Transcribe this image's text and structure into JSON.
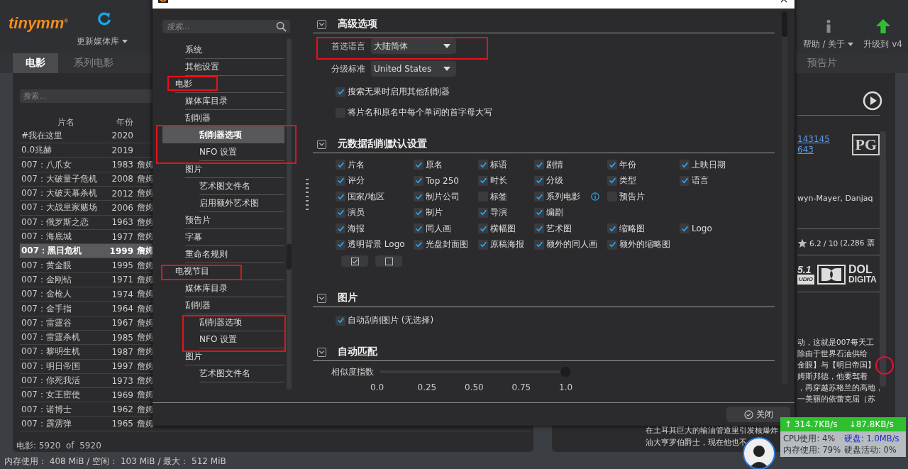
{
  "app": {
    "logo": "tinymm",
    "logo_mark": "®",
    "toolbar": [
      {
        "label": "更新媒体库",
        "dropdown": true
      }
    ],
    "toolbar_right": [
      {
        "kind": "help",
        "label": "帮助 / 关于",
        "dropdown": true
      },
      {
        "kind": "upgrade",
        "label": "升级到 v4",
        "dropdown": false
      }
    ],
    "tabs": [
      {
        "label": "电影",
        "selected": true
      },
      {
        "label": "系列电影",
        "selected": false
      }
    ],
    "tabs_right": [
      {
        "label": "预告片",
        "selected": false
      }
    ]
  },
  "movie_list": {
    "search": {
      "placeholder": "搜索..."
    },
    "columns": [
      "片名",
      "年份"
    ],
    "rows": [
      {
        "title": "#我在这里",
        "year": "2020",
        "column_3": "",
        "selected": false
      },
      {
        "title": "0.0兆赫",
        "year": "2019",
        "column_3": "",
        "selected": false
      },
      {
        "title": "007：八爪女",
        "year": "1983",
        "column_3": "詹姆",
        "selected": false
      },
      {
        "title": "007：大破量子危机",
        "year": "2008",
        "column_3": "詹姆",
        "selected": false
      },
      {
        "title": "007：大破天幕杀机",
        "year": "2012",
        "column_3": "詹姆",
        "selected": false
      },
      {
        "title": "007：大战皇家赌场",
        "year": "2006",
        "column_3": "詹姆",
        "selected": false
      },
      {
        "title": "007：俄罗斯之恋",
        "year": "1963",
        "column_3": "詹姆",
        "selected": false
      },
      {
        "title": "007：海底城",
        "year": "1977",
        "column_3": "詹姆",
        "selected": false
      },
      {
        "title": "007：黑日危机",
        "year": "1999",
        "column_3": "詹姆",
        "selected": true
      },
      {
        "title": "007：黄金眼",
        "year": "1995",
        "column_3": "詹姆",
        "selected": false
      },
      {
        "title": "007：金刚钻",
        "year": "1971",
        "column_3": "詹姆",
        "selected": false
      },
      {
        "title": "007：金枪人",
        "year": "1974",
        "column_3": "詹姆",
        "selected": false
      },
      {
        "title": "007：金手指",
        "year": "1964",
        "column_3": "詹姆",
        "selected": false
      },
      {
        "title": "007：雷霆谷",
        "year": "1967",
        "column_3": "詹姆",
        "selected": false
      },
      {
        "title": "007：雷霆杀机",
        "year": "1985",
        "column_3": "詹姆",
        "selected": false
      },
      {
        "title": "007：黎明生机",
        "year": "1987",
        "column_3": "詹姆",
        "selected": false
      },
      {
        "title": "007：明日帝国",
        "year": "1997",
        "column_3": "詹姆",
        "selected": false
      },
      {
        "title": "007：你死我活",
        "year": "1973",
        "column_3": "詹姆",
        "selected": false
      },
      {
        "title": "007：女王密使",
        "year": "1969",
        "column_3": "詹姆",
        "selected": false
      },
      {
        "title": "007：诺博士",
        "year": "1962",
        "column_3": "詹姆",
        "selected": false
      },
      {
        "title": "007：霹雳弹",
        "year": "1965",
        "column_3": "詹姆",
        "selected": false
      }
    ],
    "footer": {
      "label": "电影:",
      "shown": "5920",
      "of": "of",
      "total": "5920"
    }
  },
  "detail": {
    "ids": [
      "143145",
      "643"
    ],
    "studios": "wyn-Mayer, Danjaq",
    "rating": "6.2 / 10",
    "votes": "(2,286 票",
    "audio": "5.1",
    "audio_sub": "UDIO",
    "dolby": "DOL",
    "dolby_sub": "DIGITA",
    "logo": "PG",
    "plot_tail": [
      "动，这就是007每天工",
      "除由于世界石油供给",
      "金眼】与【明日帝国】",
      "姆斯邦德，他要驾着",
      "，再穿越苏格兰的高地，",
      "一美丽的依蕾克屈（苏"
    ],
    "plot_lines": [
      "在土耳其巨大的输油管道里引发核爆炸",
      "油大亨罗伯爵士，现在他也不"
    ]
  },
  "status_bar": "内存使用： 408 MiB / 空闲： 103 MiB / 最大： 512 MiB",
  "dialog": {
    "search": {
      "placeholder": "搜索..."
    },
    "tree": {
      "continued": [
        {
          "label": "系统",
          "selected": false
        },
        {
          "label": "其他设置",
          "selected": false
        }
      ],
      "items": [
        {
          "label": "电影",
          "selected": false,
          "children": [
            {
              "label": "媒体库目录",
              "selected": false
            },
            {
              "label": "刮削器",
              "selected": false,
              "children": [
                {
                  "label": "刮削器选项",
                  "selected": true
                },
                {
                  "label": "NFO 设置",
                  "selected": false
                }
              ]
            },
            {
              "label": "图片",
              "selected": false,
              "children": [
                {
                  "label": "艺术图文件名",
                  "selected": false
                },
                {
                  "label": "启用额外艺术图",
                  "selected": false
                }
              ]
            },
            {
              "label": "预告片",
              "selected": false
            },
            {
              "label": "字幕",
              "selected": false
            },
            {
              "label": "重命名规则",
              "selected": false
            }
          ]
        },
        {
          "label": "电视节目",
          "selected": false,
          "children": [
            {
              "label": "媒体库目录",
              "selected": false
            },
            {
              "label": "刮削器",
              "selected": false,
              "children": [
                {
                  "label": "刮削器选项",
                  "selected": false
                },
                {
                  "label": "NFO 设置",
                  "selected": false
                }
              ]
            },
            {
              "label": "图片",
              "selected": false,
              "children": [
                {
                  "label": "艺术图文件名",
                  "selected": false
                }
              ]
            }
          ]
        }
      ]
    },
    "sections": [
      {
        "kind": "advanced",
        "title": "高级选项",
        "expanded": true,
        "selects": [
          {
            "label": "首选语言",
            "value": "大陆简体"
          },
          {
            "label": "分级标准",
            "value": "United States"
          }
        ],
        "checks": [
          {
            "label": "搜索无果时启用其他刮削器",
            "checked": true
          },
          {
            "label": "将片名和原名中每个单词的首字母大写",
            "checked": false
          }
        ]
      },
      {
        "kind": "grid",
        "title": "元数据刮削默认设置",
        "expanded": true,
        "rows": [
          [
            {
              "label": "片名",
              "checked": true
            },
            {
              "label": "原名",
              "checked": true
            },
            {
              "label": "标语",
              "checked": true
            },
            {
              "label": "剧情",
              "checked": true
            },
            {
              "label": "年份",
              "checked": true
            },
            {
              "label": "上映日期",
              "checked": true
            }
          ],
          [
            {
              "label": "评分",
              "checked": true
            },
            {
              "label": "Top 250",
              "checked": true
            },
            {
              "label": "时长",
              "checked": true
            },
            {
              "label": "分级",
              "checked": true
            },
            {
              "label": "类型",
              "checked": true
            },
            {
              "label": "语言",
              "checked": true
            }
          ],
          [
            {
              "label": "国家/地区",
              "checked": true
            },
            {
              "label": "制片公司",
              "checked": true
            },
            {
              "label": "标签",
              "checked": false
            },
            {
              "label": "系列电影",
              "checked": true,
              "info": true
            },
            {
              "label": "预告片",
              "checked": false
            }
          ],
          [
            {
              "label": "演员",
              "checked": true
            },
            {
              "label": "制片",
              "checked": true
            },
            {
              "label": "导演",
              "checked": true
            },
            {
              "label": "编剧",
              "checked": true
            }
          ],
          [
            {
              "label": "海报",
              "checked": true
            },
            {
              "label": "同人画",
              "checked": true
            },
            {
              "label": "横幅图",
              "checked": true
            },
            {
              "label": "艺术图",
              "checked": true
            },
            {
              "label": "缩略图",
              "checked": true
            },
            {
              "label": "Logo",
              "checked": true
            }
          ],
          [
            {
              "label": "透明背景 Logo",
              "checked": true
            },
            {
              "label": "光盘封面图",
              "checked": true
            },
            {
              "label": "原稿海报",
              "checked": true
            },
            {
              "label": "额外的同人画",
              "checked": true
            },
            {
              "label": "额外的缩略图",
              "checked": true
            }
          ]
        ]
      },
      {
        "kind": "images",
        "title": "图片",
        "expanded": true,
        "checks": [
          {
            "label": "自动刮削图片 (无选择)",
            "checked": true
          }
        ]
      },
      {
        "kind": "matching",
        "title": "自动匹配",
        "expanded": true,
        "slider": {
          "label": "相似度指数",
          "level": 1.0,
          "ticks": [
            "0.0",
            "0.25",
            "0.50",
            "0.75",
            "1.0"
          ]
        }
      }
    ],
    "close_button": "关闭"
  },
  "net_monitor": {
    "up": "↑ 314.7KB/s",
    "down": "↓87.8KB/s",
    "cpu": "CPU使用: 4%",
    "disk": "硬盘: 1.0MB/s",
    "mem": "内存使用: 79%",
    "disk_active": "硬盘活动: 0%"
  }
}
